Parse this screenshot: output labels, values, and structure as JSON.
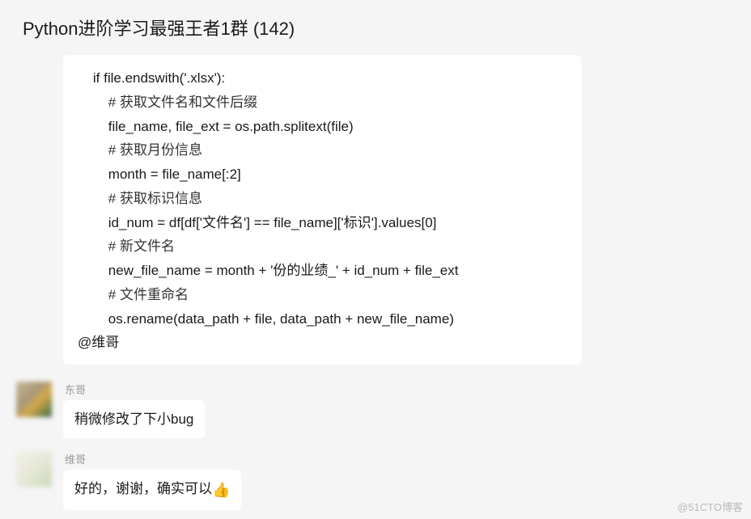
{
  "header": {
    "title": "Python进阶学习最强王者1群 (142)"
  },
  "messages": [
    {
      "sender": "",
      "type": "code",
      "code_lines": [
        "    if file.endswith('.xlsx'):",
        "        # 获取文件名和文件后缀",
        "        file_name, file_ext = os.path.splitext(file)",
        "        # 获取月份信息",
        "        month = file_name[:2]",
        "        # 获取标识信息",
        "        id_num = df[df['文件名'] == file_name]['标识'].values[0]",
        "        # 新文件名",
        "        new_file_name = month + '份的业绩_' + id_num + file_ext",
        "        # 文件重命名",
        "        os.rename(data_path + file, data_path + new_file_name)"
      ],
      "mention": "@维哥"
    },
    {
      "sender": "东哥",
      "type": "text",
      "text": "稍微修改了下小bug"
    },
    {
      "sender": "维哥",
      "type": "text",
      "text": "好的，谢谢，确实可以",
      "emoji": "👍"
    }
  ],
  "watermark": "@51CTO博客"
}
